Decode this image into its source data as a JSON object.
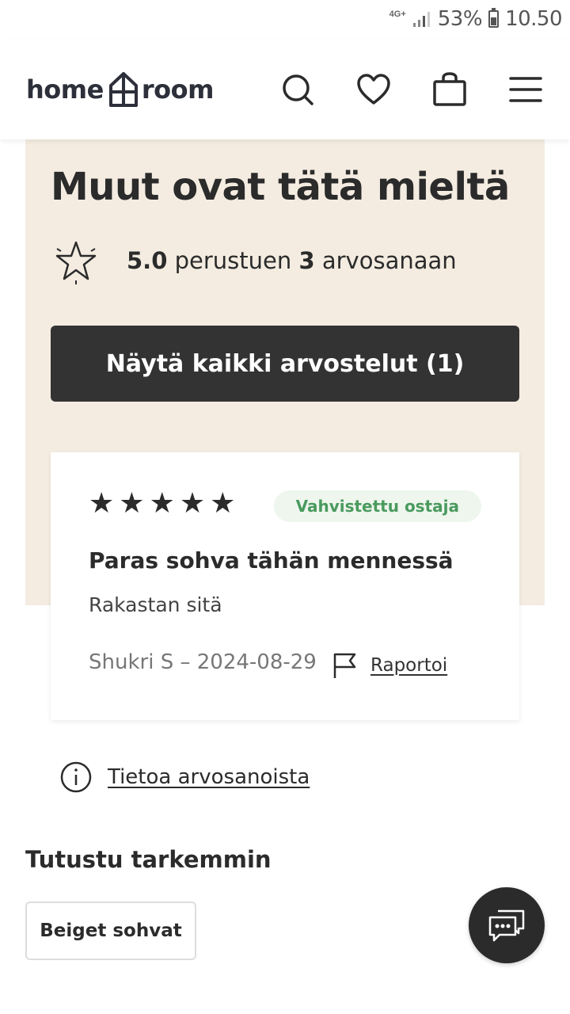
{
  "status_bar": {
    "network": "4G+",
    "battery": "53%",
    "battery_level": 0.53,
    "time": "10.50"
  },
  "header": {
    "logo_left": "home",
    "logo_right": "room",
    "icons": [
      "search-icon",
      "heart-icon",
      "bag-icon",
      "menu-icon"
    ]
  },
  "reviews": {
    "title": "Muut ovat tätä mieltä",
    "rating_value": "5.0",
    "rating_mid": "perustuen",
    "rating_count": "3",
    "rating_suffix": "arvosanaan",
    "show_all_label": "Näytä kaikki arvostelut (1)"
  },
  "review_card": {
    "stars": 5,
    "badge": "Vahvistettu ostaja",
    "title": "Paras sohva tähän mennessä",
    "body": "Rakastan sitä",
    "meta": "Shukri S – 2024-08-29",
    "report_label": "Raportoi"
  },
  "info_link": "Tietoa arvosanoista",
  "explore": {
    "heading": "Tutustu tarkemmin",
    "chips": [
      "Beiget sohvat"
    ]
  },
  "colors": {
    "beige_bg": "#f4ece1",
    "button_dark": "#333333",
    "badge_green": "#4a9a5e",
    "badge_bg": "#eef6ee"
  }
}
